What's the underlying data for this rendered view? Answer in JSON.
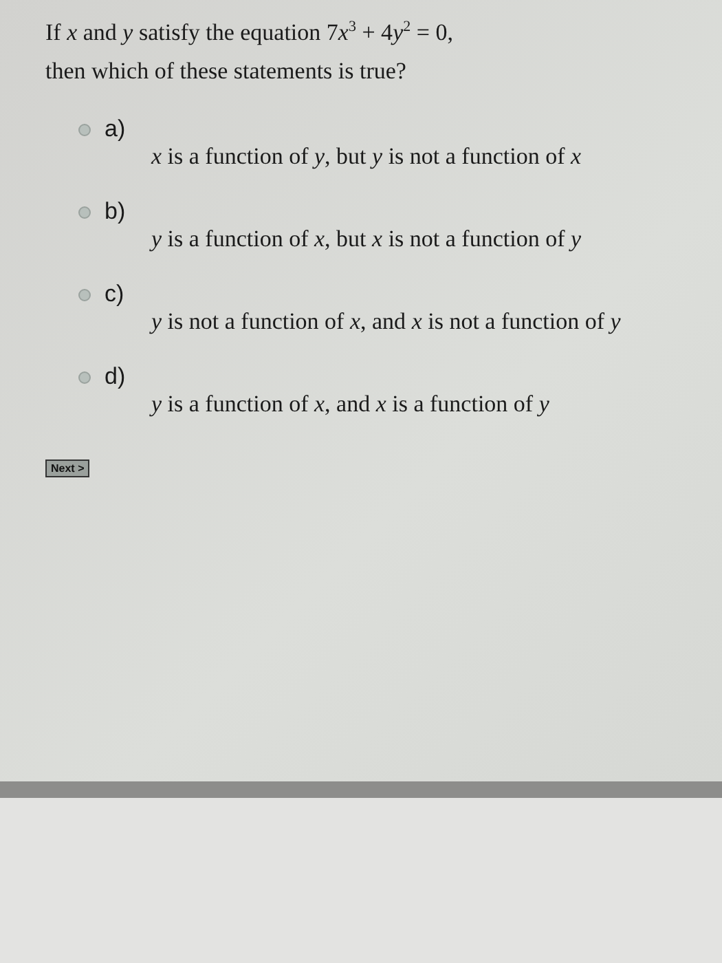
{
  "question": [
    [
      {
        "kind": "text",
        "s": "If "
      },
      {
        "kind": "var",
        "s": "x"
      },
      {
        "kind": "text",
        "s": " and "
      },
      {
        "kind": "var",
        "s": "y"
      },
      {
        "kind": "text",
        "s": " satisfy the equation 7"
      },
      {
        "kind": "var",
        "s": "x"
      },
      {
        "kind": "sup",
        "s": "3"
      },
      {
        "kind": "text",
        "s": " + 4"
      },
      {
        "kind": "var",
        "s": "y"
      },
      {
        "kind": "sup",
        "s": "2"
      },
      {
        "kind": "text",
        "s": " = 0,"
      }
    ],
    [
      {
        "kind": "text",
        "s": "then which of these statements is true?"
      }
    ]
  ],
  "options": [
    {
      "label": "a)",
      "text": "*x* is a function of *y*, but *y* is not a function of *x*",
      "selected": false
    },
    {
      "label": "b)",
      "text": "*y* is a function of *x*, but *x* is not a function of *y*",
      "selected": false
    },
    {
      "label": "c)",
      "text": "*y* is not a function of *x*, and *x* is not a function of *y*",
      "selected": false
    },
    {
      "label": "d)",
      "text": "*y* is a function of *x*, and *x* is a function of *y*",
      "selected": false
    }
  ],
  "next_button": "Next >"
}
